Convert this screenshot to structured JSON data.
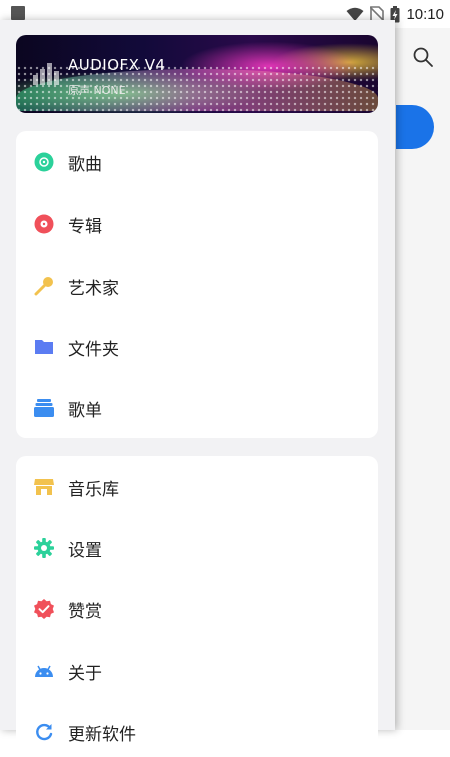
{
  "status_bar": {
    "time": "10:10"
  },
  "drawer": {
    "banner": {
      "title": "AUDIOFX V4",
      "subtitle": "原声 NONE"
    },
    "primary_items": [
      {
        "label": "歌曲",
        "icon": "disc-icon",
        "color": "#2bd19a"
      },
      {
        "label": "专辑",
        "icon": "album-icon",
        "color": "#f0505a"
      },
      {
        "label": "艺术家",
        "icon": "microphone-icon",
        "color": "#f2c24e"
      },
      {
        "label": "文件夹",
        "icon": "folder-icon",
        "color": "#5b7cf2"
      },
      {
        "label": "歌单",
        "icon": "playlist-icon",
        "color": "#3b8df0"
      }
    ],
    "secondary_items": [
      {
        "label": "音乐库",
        "icon": "store-icon",
        "color": "#f2c24e"
      },
      {
        "label": "设置",
        "icon": "gear-icon",
        "color": "#2bd19a"
      },
      {
        "label": "赞赏",
        "icon": "badge-check-icon",
        "color": "#f0505a"
      },
      {
        "label": "关于",
        "icon": "android-icon",
        "color": "#3b8df0"
      },
      {
        "label": "更新软件",
        "icon": "refresh-icon",
        "color": "#3b8df0"
      }
    ]
  },
  "background": {
    "accent": "#1a73e8"
  }
}
